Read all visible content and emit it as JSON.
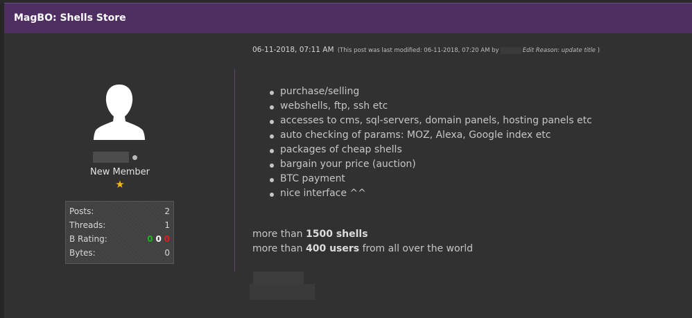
{
  "window": {
    "title": "MagBO: Shells Store"
  },
  "post": {
    "datetime": "06-11-2018, 07:11 AM",
    "modified_prefix": "(This post was last modified: 06-11-2018, 07:20 AM by",
    "edit_reason": "Edit Reason: update title",
    "modified_suffix": ")",
    "features": [
      "purchase/selling",
      "webshells, ftp, ssh etc",
      "accesses to cms, sql-servers, domain panels, hosting panels etc",
      "auto checking of params: MOZ, Alexa, Google index etc",
      "packages of cheap shells",
      "bargain your price (auction)",
      "BTC payment",
      "nice interface ^^"
    ],
    "summary": {
      "line1_prefix": "more than",
      "line1_bold": "1500 shells",
      "line2_prefix": "more than",
      "line2_bold": "400 users",
      "line2_suffix": "from all over the world"
    }
  },
  "user": {
    "title": "New Member",
    "star": "★",
    "stats": [
      {
        "label": "Posts:",
        "value": "2"
      },
      {
        "label": "Threads:",
        "value": "1"
      },
      {
        "label": "B Rating:",
        "value": ""
      },
      {
        "label": "Bytes:",
        "value": "0"
      }
    ],
    "rating": {
      "positive": "0",
      "neutral": "0",
      "negative": "0"
    }
  },
  "colors": {
    "titlebar": "#4f2f62",
    "rating_positive": "#1db51d",
    "rating_negative": "#e31a1a",
    "star": "#f2b51d"
  }
}
